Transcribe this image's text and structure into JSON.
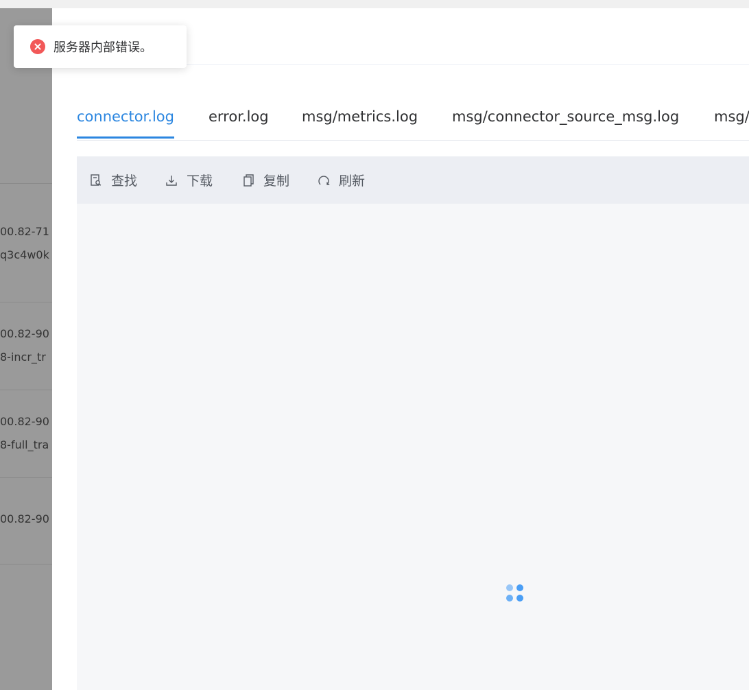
{
  "background_list": {
    "rows": [
      {
        "line1": "00.82-71",
        "line2": "q3c4w0k"
      },
      {
        "line1": "00.82-90",
        "line2": "8-incr_tr"
      },
      {
        "line1": "00.82-90",
        "line2": "8-full_tra"
      },
      {
        "line1": "00.82-90",
        "line2": ""
      }
    ]
  },
  "toast": {
    "type": "error",
    "message": "服务器内部错误。",
    "icon": "error-circle-icon",
    "color": "#f25858"
  },
  "tabs": [
    {
      "label": "connector.log",
      "active": true
    },
    {
      "label": "error.log",
      "active": false
    },
    {
      "label": "msg/metrics.log",
      "active": false
    },
    {
      "label": "msg/connector_source_msg.log",
      "active": false
    },
    {
      "label": "msg/",
      "active": false
    }
  ],
  "toolbar": {
    "find_label": "查找",
    "find_icon": "search-doc-icon",
    "download_label": "下载",
    "download_icon": "download-icon",
    "copy_label": "复制",
    "copy_icon": "copy-icon",
    "refresh_label": "刷新",
    "refresh_icon": "refresh-icon"
  },
  "log_content": {
    "state": "loading",
    "spinner_icon": "loading-dots-icon"
  },
  "colors": {
    "accent": "#2b86e0",
    "error": "#f25858",
    "spinner": "#4a9ef5"
  }
}
